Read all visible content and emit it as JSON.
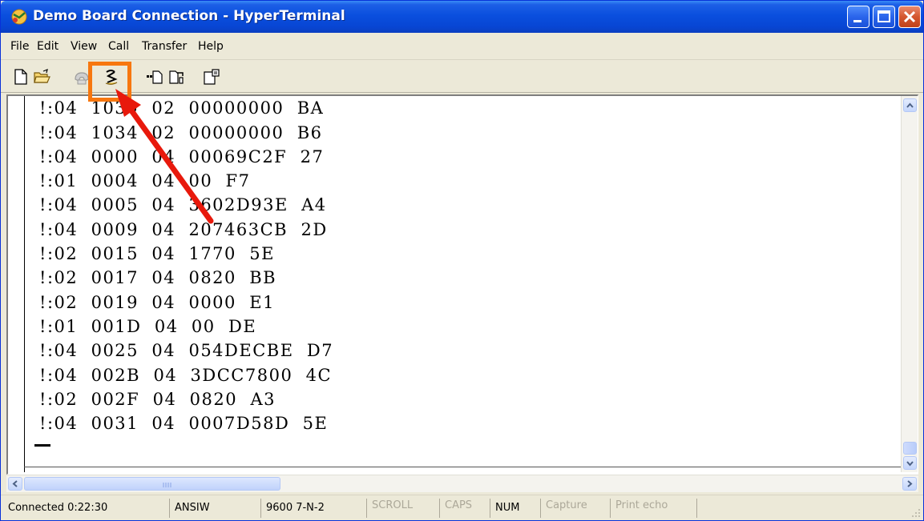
{
  "window": {
    "title": "Demo Board Connection - HyperTerminal"
  },
  "menubar": {
    "items": [
      "File",
      "Edit",
      "View",
      "Call",
      "Transfer",
      "Help"
    ]
  },
  "toolbar": {
    "buttons": [
      "new-document-icon",
      "open-folder-icon",
      "phone-call-icon",
      "disconnect-icon",
      "send-icon",
      "receive-icon",
      "properties-icon"
    ]
  },
  "terminal": {
    "lines": [
      "!:04  1030  02  00000000  BA",
      "!:04  1034  02  00000000  B6",
      "!:04  0000  04  00069C2F  27",
      "!:01  0004  04  00  F7",
      "!:04  0005  04  3602D93E  A4",
      "!:04  0009  04  207463CB  2D",
      "!:02  0015  04  1770  5E",
      "!:02  0017  04  0820  BB",
      "!:02  0019  04  0000  E1",
      "!:01  001D  04  00  DE",
      "!:04  0025  04  054DECBE  D7",
      "!:04  002B  04  3DCC7800  4C",
      "!:02  002F  04  0820  A3",
      "!:04  0031  04  0007D58D  5E"
    ]
  },
  "statusbar": {
    "connected": "Connected 0:22:30",
    "emulation": "ANSIW",
    "settings": "9600 7-N-2",
    "scroll": "SCROLL",
    "caps": "CAPS",
    "num": "NUM",
    "capture": "Capture",
    "print_echo": "Print echo"
  },
  "colors": {
    "highlight": "#f7770f",
    "arrow": "#e8190c",
    "titlebar": "#0a4fde"
  }
}
